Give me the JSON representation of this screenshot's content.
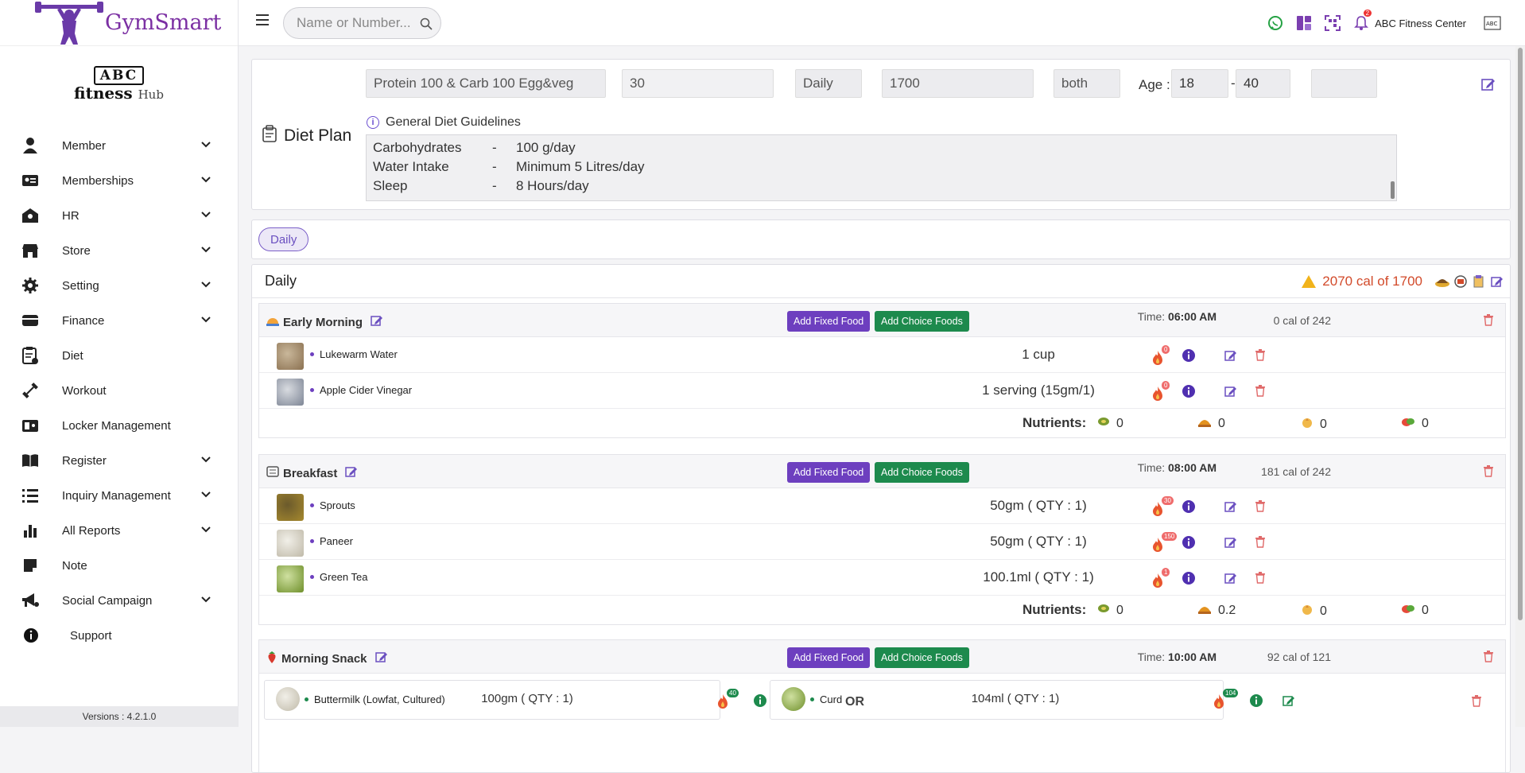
{
  "brand": {
    "name": "GymSmart"
  },
  "club": {
    "line1": "ABC",
    "line2": "fitness",
    "line3": "Hub"
  },
  "sidebar": {
    "items": [
      {
        "label": "Member",
        "icon": "person-icon",
        "chevron": true
      },
      {
        "label": "Memberships",
        "icon": "id-card-icon",
        "chevron": true
      },
      {
        "label": "HR",
        "icon": "hr-icon",
        "chevron": true
      },
      {
        "label": "Store",
        "icon": "store-icon",
        "chevron": true
      },
      {
        "label": "Setting",
        "icon": "gear-icon",
        "chevron": true
      },
      {
        "label": "Finance",
        "icon": "wallet-icon",
        "chevron": true
      },
      {
        "label": "Diet",
        "icon": "diet-clipboard-icon",
        "chevron": false
      },
      {
        "label": "Workout",
        "icon": "dumbbell-icon",
        "chevron": false
      },
      {
        "label": "Locker Management",
        "icon": "locker-icon",
        "chevron": false
      },
      {
        "label": "Register",
        "icon": "book-icon",
        "chevron": true
      },
      {
        "label": "Inquiry Management",
        "icon": "list-icon",
        "chevron": true
      },
      {
        "label": "All Reports",
        "icon": "bar-chart-icon",
        "chevron": true
      },
      {
        "label": "Note",
        "icon": "note-icon",
        "chevron": false
      },
      {
        "label": "Social Campaign",
        "icon": "megaphone-icon",
        "chevron": true
      },
      {
        "label": "Support",
        "icon": "info-icon",
        "chevron": false
      }
    ],
    "version": "Versions : 4.2.1.0"
  },
  "topbar": {
    "search_placeholder": "Name or Number...",
    "center_name": "ABC Fitness Center",
    "notif_count": "2"
  },
  "plan": {
    "name": "Protein 100 & Carb 100  Egg&veg",
    "days": "30",
    "frequency": "Daily",
    "calories": "1700",
    "type": "both",
    "age_label": "Age :",
    "age_from": "18",
    "age_sep": "-",
    "age_to": "40",
    "extra": "",
    "title": "Diet Plan",
    "guidelines_title": "General Diet Guidelines",
    "guidelines": [
      {
        "k": "Carbohydrates",
        "v": "100 g/day"
      },
      {
        "k": "Water Intake",
        "v": "Minimum 5 Litres/day"
      },
      {
        "k": "Sleep",
        "v": "8 Hours/day"
      }
    ]
  },
  "tabs": {
    "active": "Daily"
  },
  "day": {
    "title": "Daily",
    "warning": "2070 cal of 1700",
    "warning_color": "#d24a2a"
  },
  "meals": [
    {
      "title": "Early Morning",
      "icon": "sunrise-icon",
      "time_label": "Time:",
      "time": "06:00 AM",
      "cal": "0 cal of 242",
      "foods": [
        {
          "name": "Lukewarm Water",
          "qty": "1 cup",
          "cal": "0"
        },
        {
          "name": "Apple Cider Vinegar",
          "qty": "1 serving (15gm/1)",
          "cal": "0"
        }
      ],
      "nutrients": {
        "label": "Nutrients:",
        "protein": "0",
        "carb": "0",
        "fat": "0",
        "fiber": "0"
      }
    },
    {
      "title": "Breakfast",
      "icon": "breakfast-icon",
      "time_label": "Time:",
      "time": "08:00 AM",
      "cal": "181 cal of 242",
      "foods": [
        {
          "name": "Sprouts",
          "qty": "50gm ( QTY : 1)",
          "cal": "30"
        },
        {
          "name": "Paneer",
          "qty": "50gm ( QTY : 1)",
          "cal": "150"
        },
        {
          "name": "Green Tea",
          "qty": "100.1ml ( QTY : 1)",
          "cal": "1"
        }
      ],
      "nutrients": {
        "label": "Nutrients:",
        "protein": "0",
        "carb": "0.2",
        "fat": "0",
        "fiber": "0"
      }
    },
    {
      "title": "Morning Snack",
      "icon": "strawberry-icon",
      "time_label": "Time:",
      "time": "10:00 AM",
      "cal": "92 cal of 121",
      "choices": [
        {
          "name": "Buttermilk (Lowfat, Cultured)",
          "qty": "100gm ( QTY : 1)",
          "cal": "40"
        },
        {
          "name": "Curd",
          "qty": "104ml ( QTY : 1)",
          "cal": "104"
        }
      ],
      "or_label": "OR"
    }
  ],
  "buttons": {
    "add_fixed": "Add Fixed Food",
    "add_choice": "Add Choice Foods"
  }
}
